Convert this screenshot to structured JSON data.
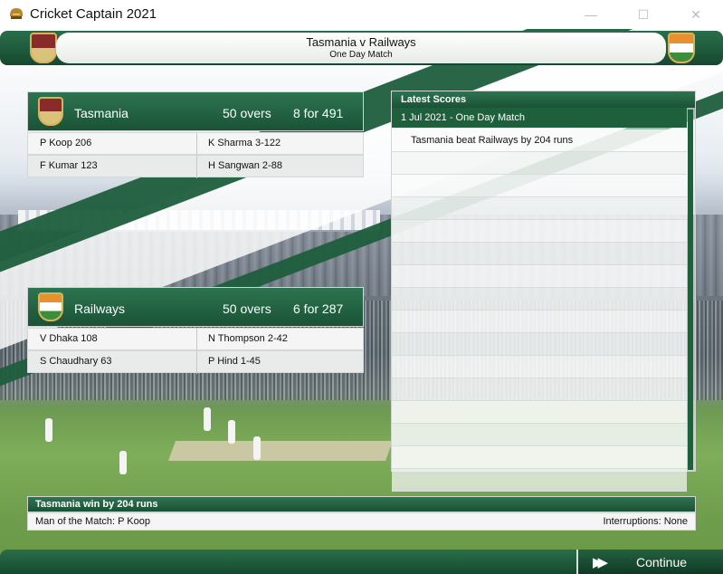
{
  "window": {
    "title": "Cricket Captain 2021",
    "minimize_glyph": "—",
    "maximize_glyph": "☐",
    "close_glyph": "✕"
  },
  "header": {
    "title": "Tasmania v Railways",
    "subtitle": "One Day Match"
  },
  "teams": [
    {
      "name": "Tasmania",
      "overs": "50 overs",
      "score": "8 for 491",
      "rows": [
        {
          "batter": "P Koop 206",
          "bowler": "K Sharma 3-122"
        },
        {
          "batter": "F Kumar 123",
          "bowler": "H Sangwan 2-88"
        }
      ]
    },
    {
      "name": "Railways",
      "overs": "50 overs",
      "score": "6 for 287",
      "rows": [
        {
          "batter": "V Dhaka 108",
          "bowler": "N Thompson 2-42"
        },
        {
          "batter": "S Chaudhary 63",
          "bowler": "P Hind 1-45"
        }
      ]
    }
  ],
  "latest_scores": {
    "title": "Latest Scores",
    "date_header": "1 Jul 2021 - One Day Match",
    "items": [
      "Tasmania beat Railways by 204 runs",
      "",
      "",
      "",
      "",
      "",
      "",
      "",
      "",
      "",
      "",
      "",
      "",
      "",
      "",
      ""
    ]
  },
  "result": {
    "headline": "Tasmania win by 204 runs",
    "man_of_match": "Man of the Match: P Koop",
    "interruptions": "Interruptions: None"
  },
  "footer": {
    "continue_label": "Continue",
    "continue_icon": "▶▶"
  },
  "colors": {
    "primary_green": "#1d5e3d",
    "accent_gold": "#d6b25a"
  }
}
